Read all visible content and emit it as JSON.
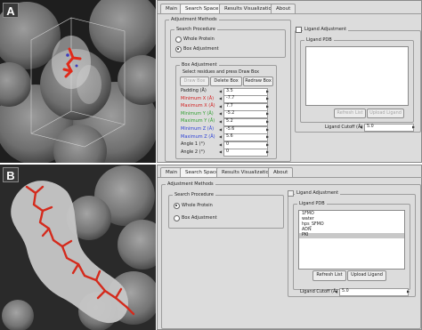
{
  "panels": [
    {
      "label": "A"
    },
    {
      "label": "B"
    }
  ],
  "windowA": {
    "tabs": [
      "Main",
      "Search Space",
      "Results Visualization",
      "About"
    ],
    "active_tab": 1,
    "adjustment_methods_title": "Adjustment Methods",
    "search_procedure_title": "Search Procedure",
    "radio_whole": "Whole Protein",
    "radio_box": "Box Adjustment",
    "selected": "box",
    "box_adjustment_title": "Box Adjustment",
    "select_hint": "Select residues and press Draw Box",
    "buttons": {
      "draw": "Draw Box",
      "delete": "Delete Box",
      "redraw": "Redraw Box"
    },
    "params": [
      {
        "label": "Padding (Å)",
        "value": "3.5",
        "color": "#222222"
      },
      {
        "label": "Minimum X (Å)",
        "value": "-7.7",
        "color": "#d11c1c"
      },
      {
        "label": "Maximum X (Å)",
        "value": "7.7",
        "color": "#d11c1c"
      },
      {
        "label": "Minimum Y (Å)",
        "value": "-5.2",
        "color": "#2f9e2f"
      },
      {
        "label": "Maximum Y (Å)",
        "value": "5.2",
        "color": "#2f9e2f"
      },
      {
        "label": "Minimum Z (Å)",
        "value": "-5.6",
        "color": "#2a3fd6"
      },
      {
        "label": "Maximum Z (Å)",
        "value": "5.6",
        "color": "#2a3fd6"
      },
      {
        "label": "Angle 1 (°)",
        "value": "0",
        "color": "#222222"
      },
      {
        "label": "Angle 2 (°)",
        "value": "0",
        "color": "#222222"
      }
    ],
    "ligand_adjustment_label": "Ligand Adjustment",
    "ligand_pdb_title": "Ligand PDB",
    "refresh_list": "Refresh List",
    "upload_ligand": "Upload Ligand",
    "ligand_cutoff_label": "Ligand Cutoff (Å)",
    "ligand_cutoff_value": "5.0"
  },
  "windowB": {
    "tabs": [
      "Main",
      "Search Space",
      "Results Visualization",
      "About"
    ],
    "active_tab": 1,
    "adjustment_methods_title": "Adjustment Methods",
    "search_procedure_title": "Search Procedure",
    "radio_whole": "Whole Protein",
    "radio_box": "Box Adjustment",
    "selected": "whole",
    "ligand_adjustment_label": "Ligand Adjustment",
    "ligand_pdb_title": "Ligand PDB",
    "ligands": [
      "1FMO",
      "water",
      "hps_SFMO",
      "ADN",
      "PKI"
    ],
    "selected_ligand": 4,
    "refresh_list": "Refresh List",
    "upload_ligand": "Upload Ligand",
    "ligand_cutoff_label": "Ligand Cutoff (Å)",
    "ligand_cutoff_value": "5.0"
  }
}
